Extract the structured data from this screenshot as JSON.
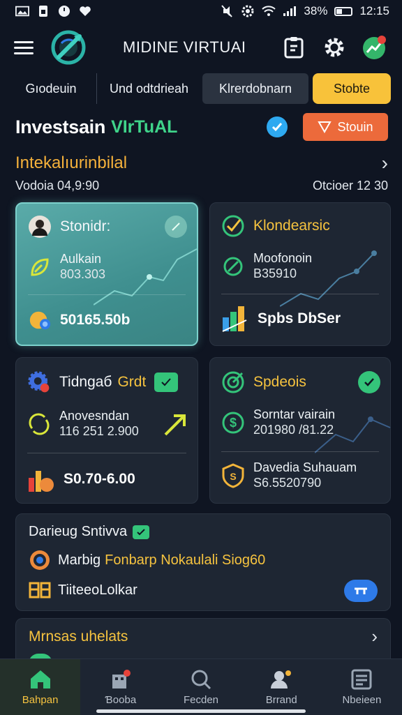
{
  "status_bar": {
    "left_icons": [
      "image-icon",
      "sim-icon",
      "power-icon",
      "heart-icon"
    ],
    "right_icons": [
      "mute-icon",
      "gear-icon",
      "wifi-icon",
      "signal-icon"
    ],
    "battery": "38%",
    "time": "12:15"
  },
  "app_bar": {
    "title": "MIDINE VIRTUAI",
    "icons": [
      "menu-icon",
      "logo-icon",
      "clipboard-icon",
      "gear-icon",
      "chart-alert-icon"
    ]
  },
  "tabs": [
    {
      "label": "Gıodeuin"
    },
    {
      "label": "Und odtdrieah"
    },
    {
      "label": "Klrerdobnarn"
    },
    {
      "label": "Stobte"
    }
  ],
  "header": {
    "title": "Investsain",
    "accent": "VIrTuAL",
    "button_label": "Stouin"
  },
  "section": {
    "title": "Intekalıurinbilal",
    "left_meta": "Vodoia 04,9:90",
    "right_meta": "Otcioer 12 30"
  },
  "cards": [
    {
      "title": "Stonidr:",
      "label": "Aulkain",
      "value": "803.303",
      "big": "50165.50b"
    },
    {
      "title": "Klondearsic",
      "label": "Moofonoin",
      "value": "B35910",
      "big": "Spbs DbSer"
    },
    {
      "title": "Tidngaб",
      "title_accent": "Grdt",
      "label": "Anovesndan",
      "value": "116 251 2.900",
      "big": "S0.70-6.00"
    },
    {
      "title": "Spdeois",
      "label": "Sorntar vairain",
      "value": "201980 /81.22",
      "label2": "Davedia Suhauam",
      "value2": "S6.5520790"
    }
  ],
  "wide_card": {
    "title": "Darieug Sntivva",
    "row2_prefix": "Marbig",
    "row2_highlight": "Fonbarp Nokaulali Siog60",
    "row3": "TiiteeoLolkar"
  },
  "partial_card": {
    "title": "Mrnsas uhelats"
  },
  "bottom_nav": [
    {
      "label": "Bahpan",
      "icon": "home-icon"
    },
    {
      "label": "Ɓooba",
      "icon": "building-icon"
    },
    {
      "label": "Fecden",
      "icon": "search-icon"
    },
    {
      "label": "Brrand",
      "icon": "user-group-icon"
    },
    {
      "label": "Nbeieen",
      "icon": "document-icon"
    }
  ],
  "colors": {
    "background": "#0f1522",
    "accent_gold": "#f6c33f",
    "accent_green": "#3fd48a",
    "accent_orange": "#ec6a3b",
    "accent_blue": "#2e7ae8",
    "teal_card": "#4d9e9c"
  }
}
